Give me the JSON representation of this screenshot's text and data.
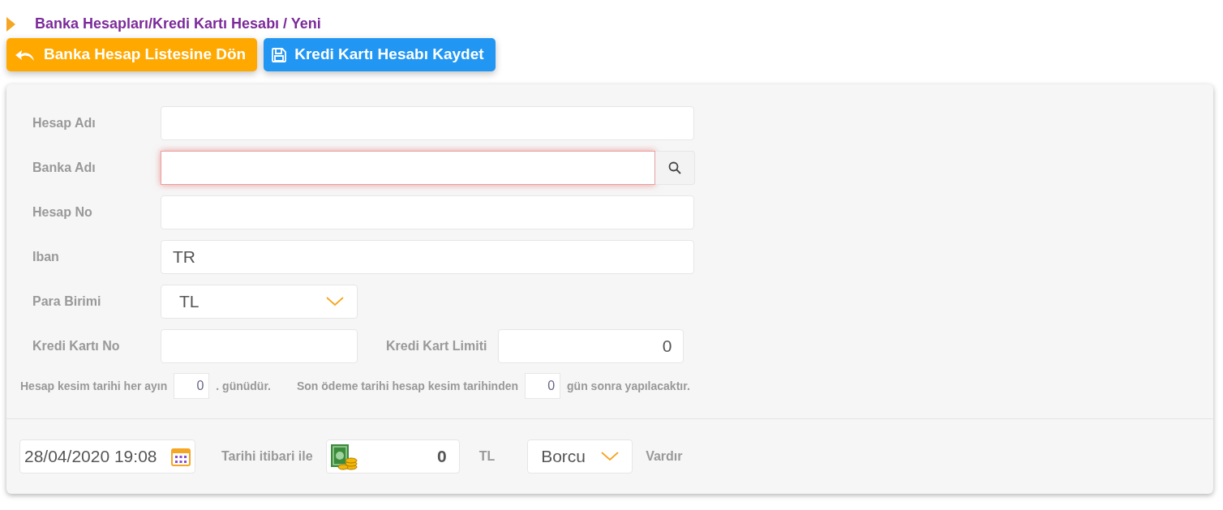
{
  "breadcrumb": "Banka Hesapları/Kredi Kartı Hesabı / Yeni",
  "buttons": [
    {
      "label": "Banka Hesap Listesine Dön",
      "kind": "back"
    },
    {
      "label": "Kredi Kartı Hesabı Kaydet",
      "kind": "save"
    }
  ],
  "fields": [
    {
      "kind": "text",
      "label": "Hesap Adı",
      "invalid": false
    },
    {
      "kind": "search",
      "label": "Banka Adı",
      "invalid": true
    },
    {
      "kind": "text",
      "label": "Hesap No",
      "invalid": false
    },
    {
      "kind": "text",
      "label": "Iban",
      "value": "TR",
      "invalid": false
    },
    {
      "kind": "select",
      "label": "Para Birimi",
      "value": "TL",
      "invalid": false
    },
    {
      "kind": "pair",
      "label": "Kredi Kartı No",
      "invalid": false,
      "label2": "Kredi Kart Limiti",
      "value2": "0"
    }
  ],
  "statement": {
    "before_day": "Hesap kesim tarihi her ayın",
    "day": "0",
    "after_day": ". günüdür.",
    "before_due": "Son ödeme tarihi hesap kesim tarihinden",
    "due": "0",
    "after_due": "gün sonra yapılacaktır."
  },
  "balance": {
    "date": "28/04/2020 19:08",
    "as_of": "Tarihi itibari ile",
    "amount": "0",
    "currency": "TL",
    "direction": "Borcu",
    "suffix": "Vardır"
  }
}
